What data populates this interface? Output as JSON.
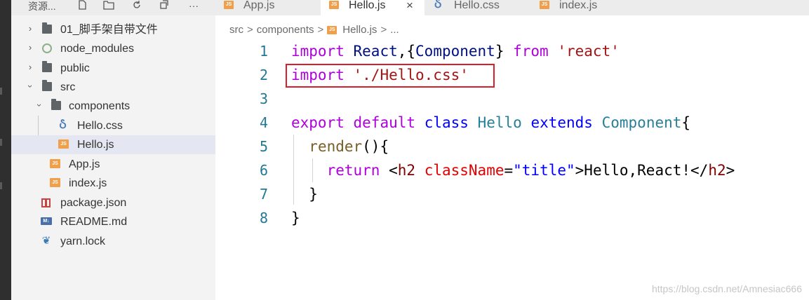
{
  "explorer": {
    "title": "资源...",
    "toolbar_icons": [
      "new-file-icon",
      "new-folder-icon",
      "refresh-icon",
      "collapse-all-icon",
      "more-icon"
    ],
    "more_label": "···",
    "tree": [
      {
        "label": "01_脚手架自带文件",
        "type": "folder",
        "expanded": false
      },
      {
        "label": "node_modules",
        "type": "node-folder",
        "expanded": false
      },
      {
        "label": "public",
        "type": "folder",
        "expanded": false
      },
      {
        "label": "src",
        "type": "folder",
        "expanded": true
      },
      {
        "label": "components",
        "type": "folder",
        "expanded": true
      },
      {
        "label": "Hello.css",
        "type": "css"
      },
      {
        "label": "Hello.js",
        "type": "js",
        "selected": true
      },
      {
        "label": "App.js",
        "type": "js"
      },
      {
        "label": "index.js",
        "type": "js"
      },
      {
        "label": "package.json",
        "type": "json"
      },
      {
        "label": "README.md",
        "type": "md"
      },
      {
        "label": "yarn.lock",
        "type": "yarn"
      }
    ]
  },
  "tabs": [
    {
      "label": "App.js",
      "icon": "js"
    },
    {
      "label": "Hello.js",
      "icon": "js",
      "active": true,
      "close": "×"
    },
    {
      "label": "Hello.css",
      "icon": "css"
    },
    {
      "label": "index.js",
      "icon": "js"
    }
  ],
  "breadcrumb": {
    "parts": [
      "src",
      "components",
      "Hello.js",
      "..."
    ],
    "separator": ">"
  },
  "editor": {
    "line_numbers": [
      "1",
      "2",
      "3",
      "4",
      "5",
      "6",
      "7",
      "8"
    ],
    "lines": [
      [
        [
          "import",
          "kw"
        ],
        [
          " ",
          ""
        ],
        [
          "React",
          "id"
        ],
        [
          ",{",
          "punc"
        ],
        [
          "Component",
          "id"
        ],
        [
          "} ",
          "punc"
        ],
        [
          "from",
          "kw"
        ],
        [
          " ",
          ""
        ],
        [
          "'react'",
          "str"
        ]
      ],
      [
        [
          "import",
          "kw"
        ],
        [
          " ",
          ""
        ],
        [
          "'./Hello.css'",
          "str"
        ]
      ],
      [],
      [
        [
          "export",
          "kw"
        ],
        [
          " ",
          ""
        ],
        [
          "default",
          "kw"
        ],
        [
          " ",
          ""
        ],
        [
          "class",
          "kb"
        ],
        [
          " ",
          ""
        ],
        [
          "Hello",
          "cls"
        ],
        [
          " ",
          ""
        ],
        [
          "extends",
          "kb"
        ],
        [
          " ",
          ""
        ],
        [
          "Component",
          "cls"
        ],
        [
          "{",
          "punc"
        ]
      ],
      [
        [
          "  ",
          ""
        ],
        [
          "render",
          "fn"
        ],
        [
          "(){",
          "punc"
        ]
      ],
      [
        [
          "    ",
          ""
        ],
        [
          "return",
          "kw"
        ],
        [
          " <",
          "punc"
        ],
        [
          "h2",
          "tag"
        ],
        [
          " ",
          ""
        ],
        [
          "className",
          "attr"
        ],
        [
          "=",
          "punc"
        ],
        [
          "\"title\"",
          "kb"
        ],
        [
          ">Hello,React!</",
          "punc"
        ],
        [
          "h2",
          "tag"
        ],
        [
          ">",
          "punc"
        ]
      ],
      [
        [
          "  ",
          ""
        ],
        [
          "}",
          "punc"
        ]
      ],
      [
        [
          "}",
          "punc"
        ]
      ]
    ],
    "highlighted_line": "2"
  },
  "watermark": "https://blog.csdn.net/Amnesiac666",
  "colors": {
    "keyword": "#af00db",
    "string": "#a31515",
    "highlight_box": "#d9202a",
    "line_number": "#237893"
  }
}
